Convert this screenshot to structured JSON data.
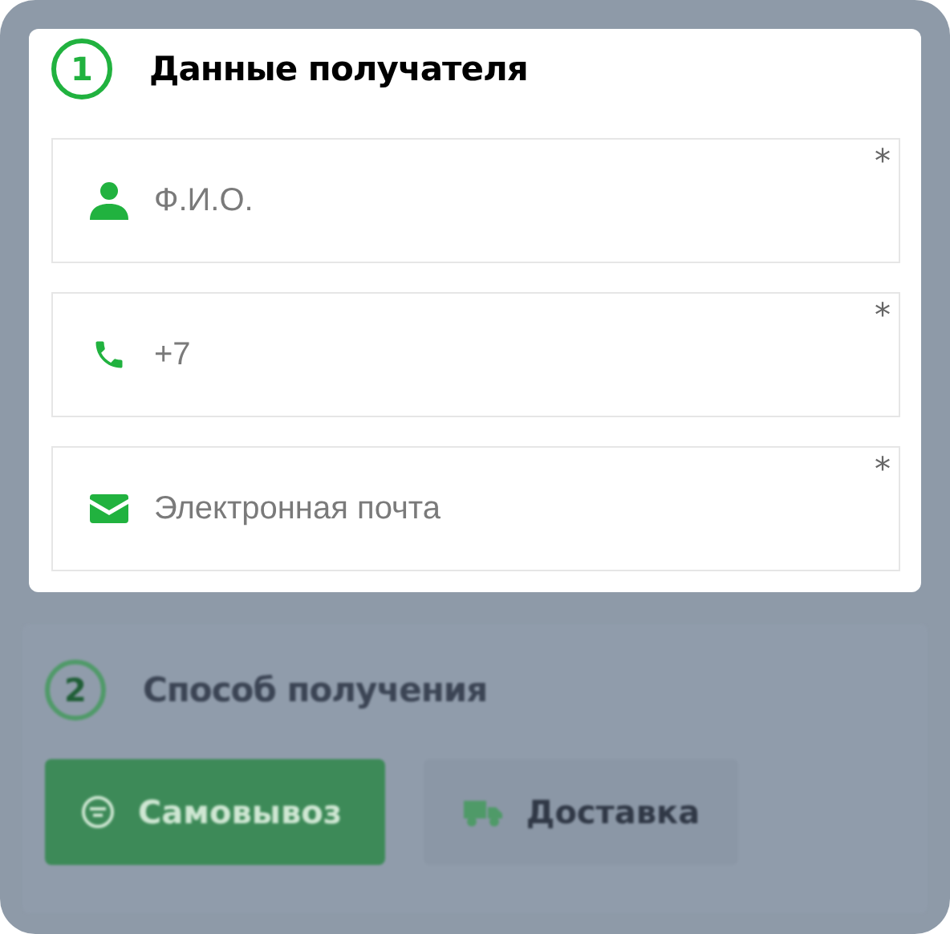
{
  "recipient": {
    "step": "1",
    "title": "Данные получателя",
    "fields": [
      {
        "kind": "person",
        "placeholder": "Ф.И.О.",
        "required_mark": "*"
      },
      {
        "kind": "phone",
        "placeholder": "+7",
        "required_mark": "*"
      },
      {
        "kind": "email",
        "placeholder": "Электронная почта",
        "required_mark": "*"
      }
    ]
  },
  "delivery": {
    "step": "2",
    "title": "Способ получения",
    "options": [
      {
        "kind": "pickup",
        "label": "Самовывоз",
        "selected": true
      },
      {
        "kind": "truck",
        "label": "Доставка",
        "selected": false
      }
    ]
  }
}
